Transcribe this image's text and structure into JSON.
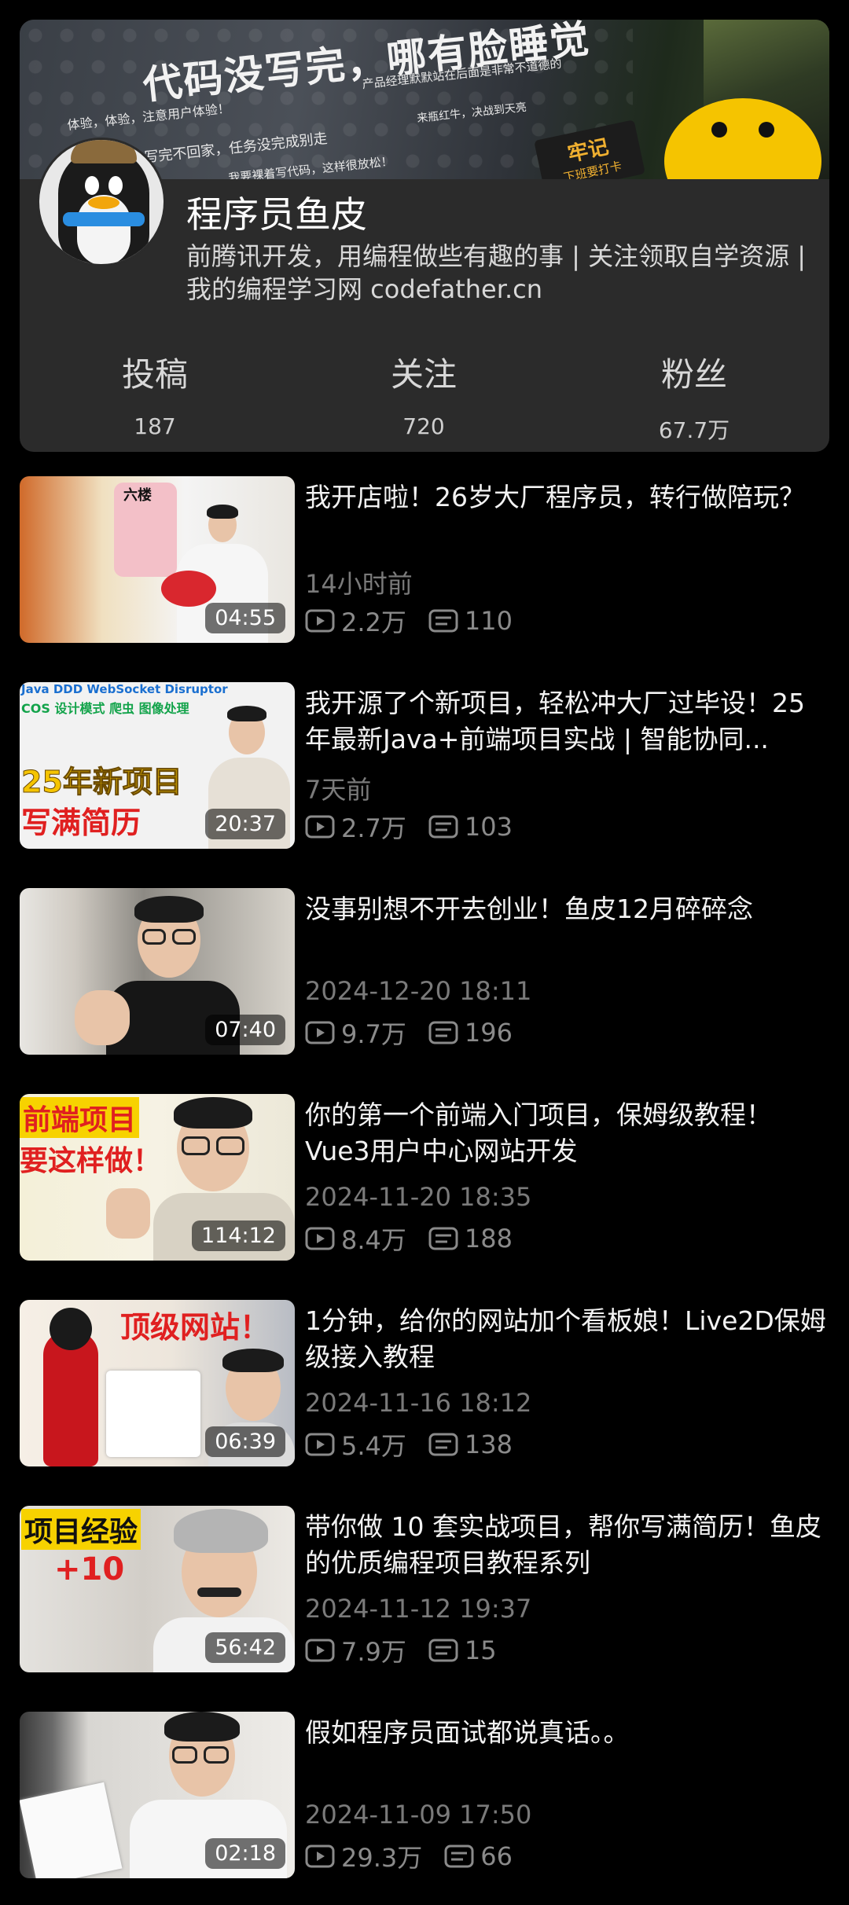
{
  "banner": {
    "headline": "代码没写完，哪有脸睡觉",
    "lines": [
      "体验，体验，注意用户体验！",
      "没写完不回家，任务没完成别走",
      "我要裸着写代码，这样很放松！",
      "产品经理默默站在后面是非常不道德的",
      "来瓶红牛，决战到天亮"
    ],
    "stamp_big": "牢记",
    "stamp_small": "下班要打卡"
  },
  "profile": {
    "name": "程序员鱼皮",
    "bio": "前腾讯开发，用编程做些有趣的事 | 关注领取自学资源 | 我的编程学习网 codefather.cn",
    "stats": {
      "posts_label": "投稿",
      "posts_value": "187",
      "following_label": "关注",
      "following_value": "720",
      "fans_label": "粉丝",
      "fans_value": "67.7万"
    }
  },
  "videos": [
    {
      "title": "我开店啦！26岁大厂程序员，转行做陪玩？",
      "date": "14小时前",
      "views": "2.2万",
      "comments": "110",
      "duration": "04:55",
      "thumb_text": "六楼"
    },
    {
      "title": "我开源了个新项目，轻松冲大厂过毕设！25年最新Java+前端项目实战 | 智能协同...",
      "date": "7天前",
      "views": "2.7万",
      "comments": "103",
      "duration": "20:37",
      "thumb_text_top": "Java DDD WebSocket Disruptor",
      "thumb_text_top2": "COS 设计模式 爬虫 图像处理",
      "thumb_text_a": "25年新项目",
      "thumb_text_b": "写满简历"
    },
    {
      "title": "没事别想不开去创业！鱼皮12月碎碎念",
      "date": "2024-12-20 18:11",
      "views": "9.7万",
      "comments": "196",
      "duration": "07:40"
    },
    {
      "title": "你的第一个前端入门项目，保姆级教程！Vue3用户中心网站开发",
      "date": "2024-11-20 18:35",
      "views": "8.4万",
      "comments": "188",
      "duration": "114:12",
      "thumb_text_a": "前端项目",
      "thumb_text_b": "要这样做！"
    },
    {
      "title": "1分钟，给你的网站加个看板娘！Live2D保姆级接入教程",
      "date": "2024-11-16 18:12",
      "views": "5.4万",
      "comments": "138",
      "duration": "06:39",
      "thumb_text_a": "顶级网站！"
    },
    {
      "title": "带你做 10 套实战项目，帮你写满简历！鱼皮的优质编程项目教程系列",
      "date": "2024-11-12 19:37",
      "views": "7.9万",
      "comments": "15",
      "duration": "56:42",
      "thumb_text_a": "项目经验",
      "thumb_text_b": "+10"
    },
    {
      "title": "假如程序员面试都说真话。。",
      "date": "2024-11-09 17:50",
      "views": "29.3万",
      "comments": "66",
      "duration": "02:18"
    }
  ]
}
